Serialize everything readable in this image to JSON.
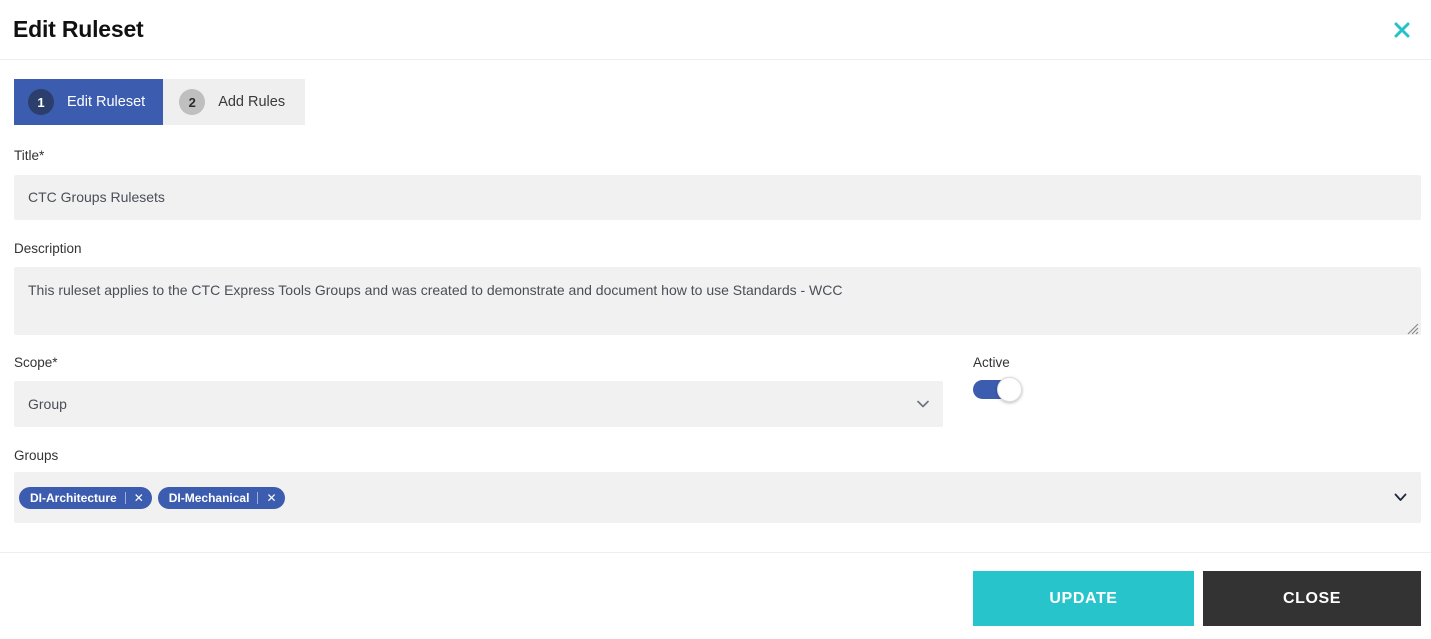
{
  "header": {
    "title": "Edit Ruleset",
    "close_icon": "close-icon"
  },
  "steps": [
    {
      "number": "1",
      "label": "Edit Ruleset",
      "active": true
    },
    {
      "number": "2",
      "label": "Add Rules",
      "active": false
    }
  ],
  "form": {
    "title_field": {
      "label": "Title*",
      "value": "CTC Groups Rulesets",
      "placeholder": ""
    },
    "description_field": {
      "label": "Description",
      "value": "This ruleset applies to the CTC Express Tools Groups and was created to demonstrate and document how to use Standards - WCC",
      "placeholder": ""
    },
    "scope_field": {
      "label": "Scope*",
      "value": "Group",
      "chevron_icon": "chevron-down-icon"
    },
    "active_field": {
      "label": "Active",
      "state": "on"
    },
    "groups_field": {
      "label": "Groups",
      "chevron_icon": "chevron-down-icon",
      "tags": [
        {
          "label": "DI-Architecture",
          "remove_icon": "close-icon"
        },
        {
          "label": "DI-Mechanical",
          "remove_icon": "close-icon"
        }
      ]
    }
  },
  "footer": {
    "update_label": "UPDATE",
    "close_label": "CLOSE"
  },
  "colors": {
    "accent_teal": "#28c4cb",
    "primary_blue": "#3c5caf",
    "badge_navy": "#2c3e6b",
    "dark_button": "#333333",
    "field_bg": "#f1f1f1"
  }
}
